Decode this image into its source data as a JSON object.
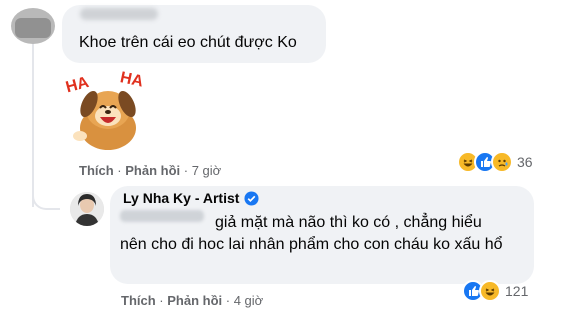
{
  "comment1": {
    "text": "Khoe trên cái eo chút được Ko",
    "sticker": "dog-ha-ha-sticker",
    "actions": {
      "like": "Thích",
      "reply": "Phản hồi",
      "time": "7 giờ"
    },
    "reactions": {
      "icons": [
        "haha-icon",
        "like-icon",
        "sad-icon"
      ],
      "count": "36"
    }
  },
  "reply1": {
    "author": "Ly Nha Ky - Artist",
    "verified_icon": "verified-badge-icon",
    "text_line1": "giả mặt mà não thì ko có , chẳng hiểu",
    "text_rest": "nên cho đi hoc lai nhân phẩm cho con cháu ko xấu hổ",
    "actions": {
      "like": "Thích",
      "reply": "Phản hồi",
      "time": "4 giờ"
    },
    "reactions": {
      "icons": [
        "like-icon",
        "haha-icon"
      ],
      "count": "121"
    }
  },
  "colors": {
    "bubble": "#f0f2f5",
    "meta": "#65676b",
    "like_blue": "#1877f2",
    "haha_yellow": "#f7b928"
  }
}
